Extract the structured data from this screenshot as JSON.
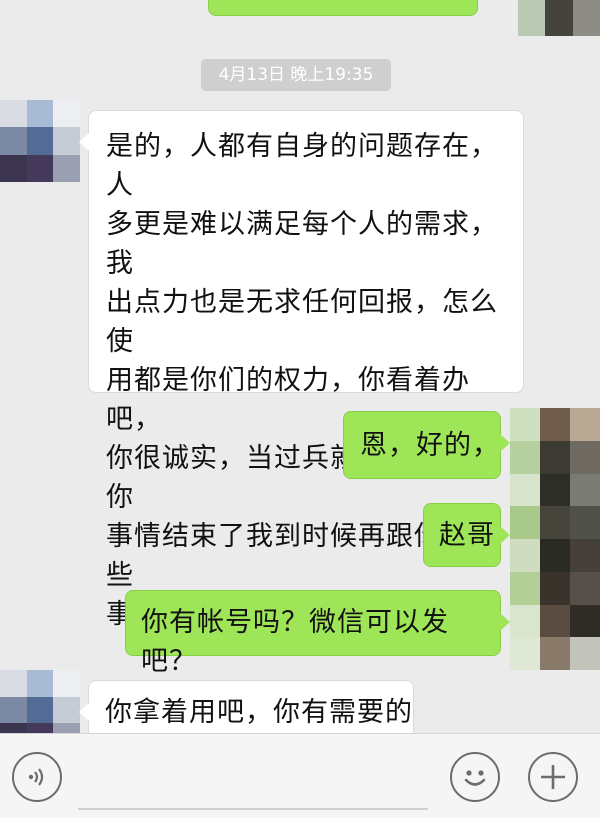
{
  "timestamp": "4月13日 晚上19:35",
  "messages": [
    {
      "side": "left",
      "text": "是的，人都有自身的问题存在，人多更是难以满足每个人的需求，我出点力也是无求任何回报，怎么使用都是你们的权力，你看着办吧，你很诚实，当过兵就是不一样，你事情结束了我到时候再跟你说一些事",
      "lines": [
        "是的，人都有自身的问题存在，人",
        "多更是难以满足每个人的需求，我",
        "出点力也是无求任何回报，怎么使",
        "用都是你们的权力，你看着办吧，",
        "你很诚实，当过兵就是不一样，你",
        "事情结束了我到时候再跟你说一些",
        "事"
      ]
    },
    {
      "side": "right",
      "text": "恩，好的，"
    },
    {
      "side": "right",
      "text": "赵哥"
    },
    {
      "side": "right",
      "text": "你有帐号吗？微信可以发吧？"
    },
    {
      "side": "left",
      "text": "你拿着用吧，你有需要的"
    }
  ],
  "toolbar": {
    "voice_icon": "voice-icon",
    "emoji_icon": "emoji-icon",
    "plus_icon": "plus-icon"
  },
  "colors": {
    "background": "#ebebeb",
    "green_bubble": "#9ee658",
    "white_bubble": "#ffffff",
    "timestamp_bg": "#cfcfcf"
  }
}
